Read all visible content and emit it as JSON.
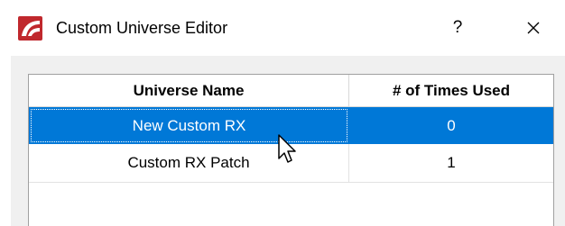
{
  "window": {
    "title": "Custom Universe Editor",
    "help_label": "?",
    "close_label": "✕"
  },
  "table": {
    "columns": [
      "Universe Name",
      "# of Times Used"
    ],
    "rows": [
      {
        "name": "New Custom RX",
        "times_used": "0",
        "selected": true
      },
      {
        "name": "Custom RX Patch",
        "times_used": "1",
        "selected": false
      }
    ]
  },
  "colors": {
    "selection": "#0078d7",
    "app_icon": "#c0282d"
  },
  "icons": {
    "app": "app-logo-icon",
    "cursor": "mouse-pointer-icon"
  }
}
